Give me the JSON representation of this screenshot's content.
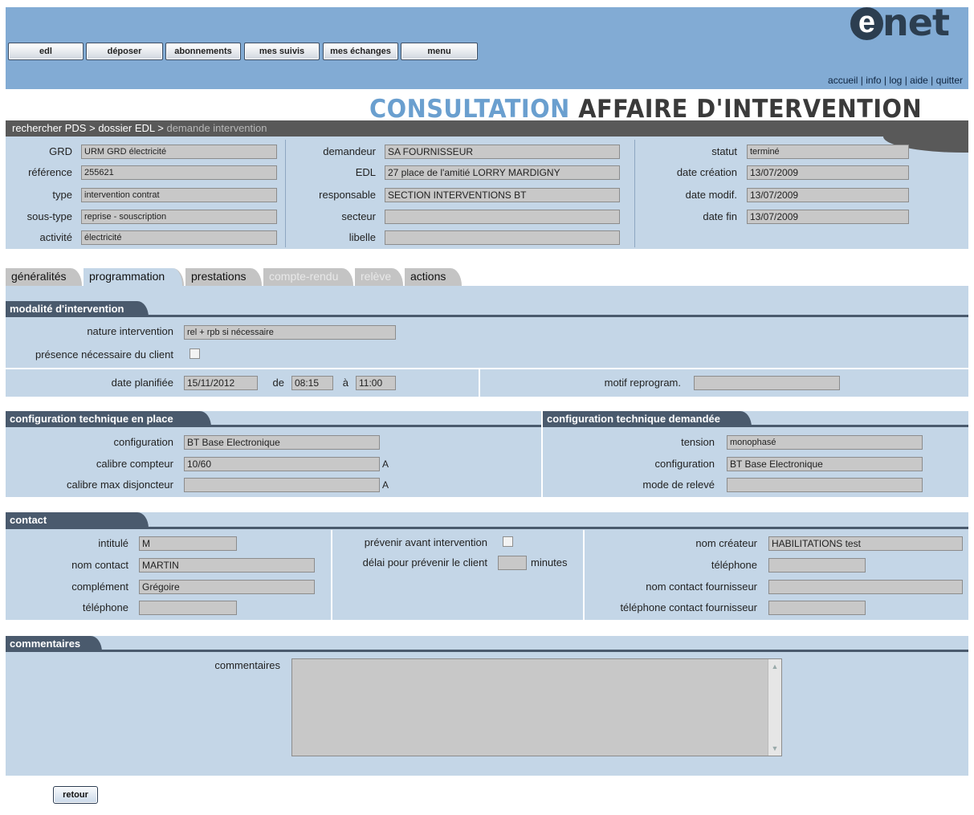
{
  "nav": {
    "buttons": [
      "edl",
      "déposer",
      "abonnements",
      "mes suivis",
      "mes échanges",
      "menu"
    ],
    "logo_letter": "e",
    "logo_text": "net",
    "links": [
      "accueil",
      "info",
      "log",
      "aide",
      "quitter"
    ]
  },
  "heading": {
    "part1": "CONSULTATION",
    "part2": "AFFAIRE D'INTERVENTION"
  },
  "breadcrumb": {
    "item1": "rechercher PDS >",
    "item2": "dossier EDL >",
    "current": "demande intervention"
  },
  "info": {
    "grd_label": "GRD",
    "grd": "URM GRD électricité",
    "reference_label": "référence",
    "reference": "255621",
    "type_label": "type",
    "type": "intervention contrat",
    "soustype_label": "sous-type",
    "soustype": "reprise - souscription",
    "activite_label": "activité",
    "activite": "électricité",
    "demandeur_label": "demandeur",
    "demandeur": "SA FOURNISSEUR",
    "edl_label": "EDL",
    "edl": "27 place de l'amitié LORRY MARDIGNY",
    "responsable_label": "responsable",
    "responsable": "SECTION INTERVENTIONS BT",
    "secteur_label": "secteur",
    "secteur": "",
    "libelle_label": "libelle",
    "libelle": "",
    "statut_label": "statut",
    "statut": "terminé",
    "date_creation_label": "date création",
    "date_creation": "13/07/2009",
    "date_modif_label": "date modif.",
    "date_modif": "13/07/2009",
    "date_fin_label": "date fin",
    "date_fin": "13/07/2009"
  },
  "tabs": [
    "généralités",
    "programmation",
    "prestations",
    "compte-rendu",
    "relève",
    "actions"
  ],
  "modalite": {
    "title": "modalité d'intervention",
    "nature_label": "nature intervention",
    "nature": "rel + rpb si nécessaire",
    "presence_label": "présence nécessaire du client",
    "date_label": "date planifiée",
    "date": "15/11/2012",
    "de_label": "de",
    "heure_debut": "08:15",
    "a_label": "à",
    "heure_fin": "11:00",
    "motif_label": "motif reprogram.",
    "motif": ""
  },
  "config_place": {
    "title": "configuration technique en place",
    "configuration_label": "configuration",
    "configuration": "BT Base Electronique",
    "calibre_label": "calibre compteur",
    "calibre": "10/60",
    "calibre_unit": "A",
    "calibre_max_label": "calibre max disjoncteur",
    "calibre_max": "",
    "calibre_max_unit": "A"
  },
  "config_demandee": {
    "title": "configuration technique demandée",
    "tension_label": "tension",
    "tension": "monophasé",
    "configuration_label": "configuration",
    "configuration": "BT Base Electronique",
    "mode_releve_label": "mode de relevé",
    "mode_releve": ""
  },
  "contact": {
    "title": "contact",
    "intitule_label": "intitulé",
    "intitule": "M",
    "nom_label": "nom contact",
    "nom": "MARTIN",
    "complement_label": "complément",
    "complement": "Grégoire",
    "telephone_label": "téléphone",
    "telephone": "",
    "prevenir_label": "prévenir avant intervention",
    "delai_label": "délai pour prévenir le client",
    "delai": "",
    "delai_unit": "minutes",
    "createur_label": "nom créateur",
    "createur": "HABILITATIONS test",
    "tel_createur_label": "téléphone",
    "tel_createur": "",
    "nom_fournisseur_label": "nom contact fournisseur",
    "nom_fournisseur": "",
    "tel_fournisseur_label": "téléphone contact fournisseur",
    "tel_fournisseur": ""
  },
  "commentaires": {
    "title": "commentaires",
    "label": "commentaires",
    "value": ""
  },
  "retour_label": "retour",
  "colors": {
    "header_blue": "#82abd4",
    "panel_blue": "#c4d6e7",
    "section_dark": "#4a5a6d",
    "heading_blue": "#6a9fcf"
  }
}
